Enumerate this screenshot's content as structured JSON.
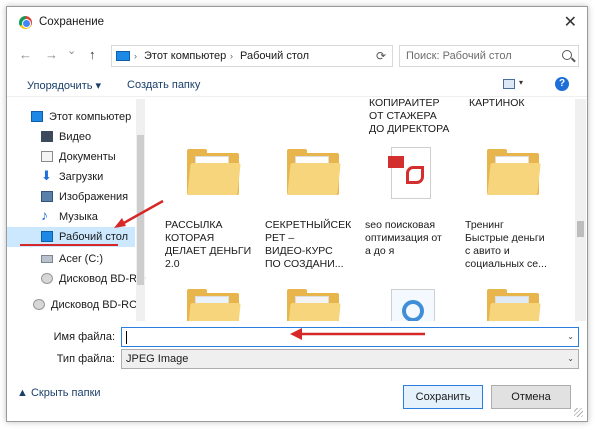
{
  "window": {
    "title": "Сохранение",
    "close_glyph": "✕"
  },
  "nav": {
    "back": "←",
    "forward": "→",
    "dropdown": "⌄",
    "up": "↑",
    "breadcrumbs": [
      "Этот компьютер",
      "Рабочий стол"
    ],
    "crumb_sep": "›",
    "refresh": "⟳",
    "search_placeholder": "Поиск: Рабочий стол"
  },
  "toolbar": {
    "organize_label": "Упорядочить ▾",
    "new_folder_label": "Создать папку",
    "view_arrow": "▾",
    "help": "?"
  },
  "sidebar": {
    "items": [
      {
        "label": "Этот компьютер",
        "icon": "pc-icon"
      },
      {
        "label": "Видео",
        "icon": "video-icon"
      },
      {
        "label": "Документы",
        "icon": "documents-icon"
      },
      {
        "label": "Загрузки",
        "icon": "downloads-icon"
      },
      {
        "label": "Изображения",
        "icon": "pictures-icon"
      },
      {
        "label": "Музыка",
        "icon": "music-icon"
      },
      {
        "label": "Рабочий стол",
        "icon": "desktop-icon",
        "selected": true
      },
      {
        "label": "Acer (C:)",
        "icon": "drive-icon"
      },
      {
        "label": "Дисковод BD-RO",
        "icon": "disc-icon"
      },
      {
        "label": "Дисковод BD-ROI",
        "icon": "disc-icon"
      }
    ]
  },
  "files": {
    "top_labels": [
      "КОПИРАЙТЕР\nОТ СТАЖЕРА\nДО ДИРЕКТОРА",
      "КАРТИНОК"
    ],
    "items": [
      {
        "label": "РАССЫЛКА\nКОТОРАЯ\nДЕЛАЕТ ДЕНЬГИ\n2.0",
        "type": "folder"
      },
      {
        "label": "СЕКРЕТНЫЙСЕК\nРЕТ –\nВИДЕО-КУРС\nПО СОЗДАНИ...",
        "type": "folder"
      },
      {
        "label": "seo поисковая\nоптимизация от\nа до я",
        "type": "pdf"
      },
      {
        "label": "Тренинг\nБыстрые деньги\nс авито и\nсоциальных се...",
        "type": "folder"
      }
    ]
  },
  "form": {
    "filename_label": "Имя файла:",
    "filename_value": "",
    "filetype_label": "Тип файла:",
    "filetype_value": "JPEG Image",
    "dd_arrow": "⌄"
  },
  "footer": {
    "hide_folders_label": "▲  Скрыть папки",
    "save_label": "Сохранить",
    "cancel_label": "Отмена"
  },
  "colors": {
    "accent": "#2a7de1",
    "selected_bg": "#cce8ff",
    "annotation": "#d62828",
    "folder": "#e8b54c"
  }
}
